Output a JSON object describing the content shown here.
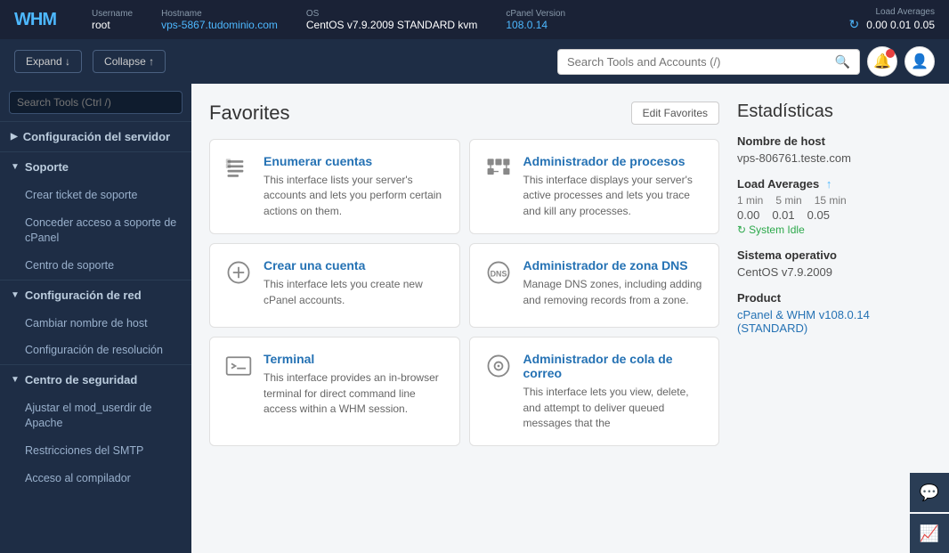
{
  "topbar": {
    "logo": "WHM",
    "username_label": "Username",
    "username": "root",
    "hostname_label": "Hostname",
    "hostname": "vps-5867.tudominio.com",
    "os_label": "OS",
    "os": "CentOS v7.9.2009 STANDARD kvm",
    "cpanel_label": "cPanel Version",
    "cpanel": "108.0.14",
    "load_avg_label": "Load Averages",
    "load_avg_values": "0.00  0.01  0.05"
  },
  "second_bar": {
    "expand_label": "Expand ↓",
    "collapse_label": "Collapse ↑",
    "search_placeholder": "Search Tools and Accounts (/)"
  },
  "sidebar": {
    "search_placeholder": "Search Tools (Ctrl /)",
    "sections": [
      {
        "title": "Configuración del servidor",
        "expanded": false,
        "items": []
      },
      {
        "title": "Soporte",
        "expanded": true,
        "items": [
          "Crear ticket de soporte",
          "Conceder acceso a soporte de cPanel",
          "Centro de soporte"
        ]
      },
      {
        "title": "Configuración de red",
        "expanded": true,
        "items": [
          "Cambiar nombre de host",
          "Configuración de resolución"
        ]
      },
      {
        "title": "Centro de seguridad",
        "expanded": true,
        "items": [
          "Ajustar el mod_userdir de Apache",
          "Restricciones del SMTP",
          "Acceso al compilador"
        ]
      }
    ]
  },
  "favorites": {
    "title": "Favorites",
    "edit_button": "Edit Favorites",
    "cards": [
      {
        "title": "Enumerar cuentas",
        "desc": "This interface lists your server's accounts and lets you perform certain actions on them.",
        "icon": "list"
      },
      {
        "title": "Administrador de procesos",
        "desc": "This interface displays your server's active processes and lets you trace and kill any processes.",
        "icon": "process"
      },
      {
        "title": "Crear una cuenta",
        "desc": "This interface lets you create new cPanel accounts.",
        "icon": "add-circle"
      },
      {
        "title": "Administrador de zona DNS",
        "desc": "Manage DNS zones, including adding and removing records from a zone.",
        "icon": "dns"
      },
      {
        "title": "Terminal",
        "desc": "This interface provides an in-browser terminal for direct command line access within a WHM session.",
        "icon": "terminal"
      },
      {
        "title": "Administrador de cola de correo",
        "desc": "This interface lets you view, delete, and attempt to deliver queued messages that the",
        "icon": "mail-queue"
      }
    ]
  },
  "stats": {
    "title": "Estadísticas",
    "hostname_label": "Nombre de host",
    "hostname": "vps-806761.teste.com",
    "load_avg_label": "Load Averages",
    "load_avg_cols": [
      "1 min",
      "5 min",
      "15 min"
    ],
    "load_avg_nums": [
      "0.00",
      "0.01",
      "0.05"
    ],
    "system_idle": "System Idle",
    "os_label": "Sistema operativo",
    "os": "CentOS v7.9.2009",
    "product_label": "Product",
    "product": "cPanel & WHM v108.0.14 (STANDARD)"
  },
  "floating_buttons": [
    {
      "name": "chat-icon",
      "symbol": "💬"
    },
    {
      "name": "chart-icon",
      "symbol": "📈"
    }
  ]
}
